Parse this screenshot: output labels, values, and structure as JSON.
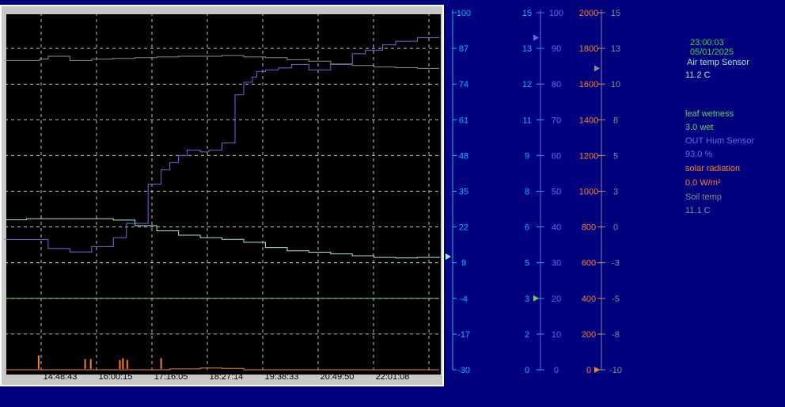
{
  "readouts": {
    "time": "23:00:03",
    "date": "05/01/2025",
    "air_temp_label": "Air temp Sensor",
    "air_temp_value": "11.2  C",
    "leaf_label": "leaf wetness",
    "leaf_value": "3.0 wet",
    "hum_label": "OUT Hum Sensor",
    "hum_value": "93.0 %",
    "solar_label": "solar radiation",
    "solar_value": "0.0 W/m²",
    "soil_label": "Soil temp",
    "soil_value": "11.1  C"
  },
  "colors": {
    "air_temp": "#9bf0c8",
    "leaf": "#57d957",
    "humidity": "#6a6ae8",
    "solar": "#ff7f27",
    "soil": "#8c8c8c",
    "time": "#3ddc3d"
  },
  "chart_data": {
    "type": "line",
    "grid": true,
    "x": [
      "14:48:43",
      "16:00:15",
      "17:16:05",
      "18:27:14",
      "19:38:33",
      "20:49:50",
      "22:01:08"
    ],
    "axes": [
      {
        "id": "air_temp",
        "color": "#00bfff",
        "ticks": [
          "100",
          "87",
          "74",
          "61",
          "48",
          "35",
          "22",
          "9",
          "-4",
          "-17",
          "-30"
        ],
        "ylim": [
          -30,
          100
        ],
        "marker": 11.2
      },
      {
        "id": "leaf",
        "color": "#00bfff",
        "ticks": [
          "15",
          "13",
          "12",
          "11",
          "9",
          "8",
          "6",
          "5",
          "3",
          "2",
          "0"
        ],
        "ylim": [
          0,
          15
        ],
        "marker": 3.0
      },
      {
        "id": "humidity",
        "color": "#6a6ae8",
        "ticks": [
          "100",
          "90",
          "80",
          "70",
          "60",
          "50",
          "40",
          "30",
          "20",
          "10",
          "0"
        ],
        "ylim": [
          0,
          100
        ],
        "marker": 93.0
      },
      {
        "id": "solar",
        "color": "#ff7f27",
        "ticks": [
          "2000",
          "1800",
          "1600",
          "1400",
          "1200",
          "1000",
          "800",
          "600",
          "400",
          "200",
          "0"
        ],
        "ylim": [
          0,
          2000
        ],
        "marker": 0.0
      },
      {
        "id": "soil",
        "color": "#8c8c8c",
        "ticks": [
          "15",
          "13",
          "10",
          "8",
          "5",
          "3",
          "0",
          "-3",
          "-5",
          "-8",
          "-10"
        ],
        "ylim": [
          -10,
          15
        ],
        "marker": 11.1
      }
    ],
    "series": [
      {
        "id": "air_temp",
        "axis": "air_temp",
        "color": "#9bf0c8",
        "t": [
          0,
          0.05,
          0.15,
          0.25,
          0.3,
          0.35,
          0.4,
          0.45,
          0.5,
          0.55,
          0.6,
          0.65,
          0.7,
          0.75,
          0.8,
          0.85,
          0.9,
          0.95,
          1.0
        ],
        "values": [
          24.6,
          25.0,
          25.0,
          24.5,
          22.5,
          20.6,
          19.0,
          18.1,
          17.5,
          16.4,
          14.5,
          13.3,
          12.8,
          12.2,
          11.5,
          10.9,
          10.7,
          10.9,
          11.2
        ]
      },
      {
        "id": "leaf",
        "axis": "leaf",
        "color": "#57d957",
        "t": [
          0,
          1.0
        ],
        "values": [
          3.0,
          3.0
        ]
      },
      {
        "id": "humidity",
        "axis": "humidity",
        "color": "#6a6ae8",
        "t": [
          0,
          0.05,
          0.1,
          0.15,
          0.2,
          0.25,
          0.28,
          0.33,
          0.36,
          0.38,
          0.4,
          0.42,
          0.45,
          0.47,
          0.5,
          0.53,
          0.55,
          0.57,
          0.58,
          0.6,
          0.63,
          0.66,
          0.7,
          0.75,
          0.8,
          0.83,
          0.87,
          0.9,
          0.95,
          1.0
        ],
        "values": [
          36.5,
          36.5,
          34.0,
          33.0,
          34.5,
          37.0,
          41.0,
          52.0,
          56.0,
          58.0,
          60.0,
          61.5,
          61.0,
          61.5,
          63.5,
          77.0,
          80.5,
          82.0,
          83.5,
          84.0,
          84.5,
          85.5,
          84.0,
          85.5,
          88.5,
          89.5,
          91.0,
          92.0,
          93.0,
          93.0
        ]
      },
      {
        "id": "solar",
        "axis": "solar",
        "color": "#ff7f27",
        "t": [
          0,
          0.2,
          0.3,
          0.38,
          0.45,
          0.5,
          0.55,
          1.0
        ],
        "values": [
          0,
          0,
          0,
          5,
          10,
          8,
          0,
          0
        ],
        "spikes": [
          {
            "t": 0.078,
            "value": 80
          },
          {
            "t": 0.185,
            "value": 60
          },
          {
            "t": 0.198,
            "value": 60
          },
          {
            "t": 0.265,
            "value": 55
          },
          {
            "t": 0.272,
            "value": 65
          },
          {
            "t": 0.282,
            "value": 55
          },
          {
            "t": 0.36,
            "value": 65
          }
        ]
      },
      {
        "id": "soil",
        "axis": "soil",
        "color": "#8c8c8c",
        "t": [
          0,
          0.08,
          0.1,
          0.15,
          0.2,
          0.25,
          0.3,
          0.35,
          0.4,
          0.45,
          0.5,
          0.55,
          0.6,
          0.65,
          0.7,
          0.75,
          0.8,
          0.85,
          0.9,
          0.95,
          1.0
        ],
        "values": [
          11.65,
          11.75,
          11.95,
          11.65,
          11.75,
          11.8,
          11.85,
          11.9,
          11.95,
          11.95,
          12.0,
          11.9,
          11.85,
          11.7,
          11.6,
          11.4,
          11.3,
          11.2,
          11.15,
          11.1,
          11.1
        ]
      }
    ]
  }
}
